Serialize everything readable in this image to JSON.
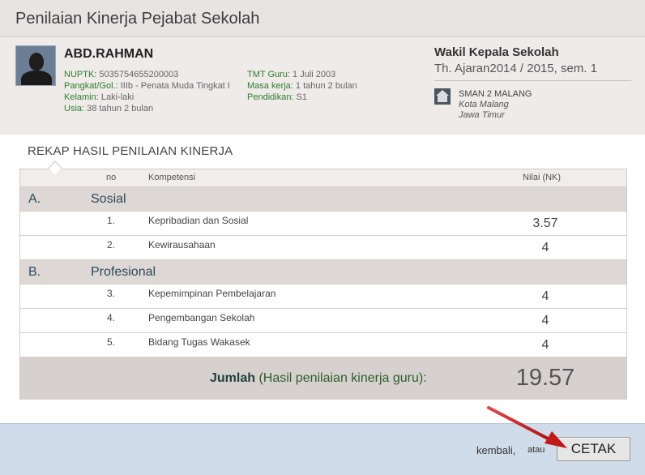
{
  "page_title": "Penilaian Kinerja Pejabat Sekolah",
  "profile": {
    "name": "ABD.RAHMAN",
    "nuptk_label": "NUPTK:",
    "nuptk_value": "5035754655200003",
    "pangkat_label": "Pangkat/Gol.:",
    "pangkat_value": "IIIb - Penata Muda Tingkat I",
    "kelamin_label": "Kelamin:",
    "kelamin_value": "Laki-laki",
    "usia_label": "Usia:",
    "usia_value": "38 tahun 2 bulan",
    "tmt_label": "TMT Guru:",
    "tmt_value": "1 Juli 2003",
    "masa_label": "Masa kerja:",
    "masa_value": "1 tahun 2 bulan",
    "pendidikan_label": "Pendidikan:",
    "pendidikan_value": "S1",
    "role": "Wakil Kepala Sekolah",
    "year": "Th. Ajaran2014 / 2015, sem. 1",
    "school_name": "SMAN 2 MALANG",
    "school_city": "Kota Malang",
    "school_province": "Jawa Timur"
  },
  "rekap": {
    "title": "REKAP HASIL PENILAIAN KINERJA",
    "col_no": "no",
    "col_kompetensi": "Kompetensi",
    "col_nilai": "Nilai (NK)",
    "categories": [
      {
        "letter": "A.",
        "name": "Sosial",
        "items": [
          {
            "no": "1.",
            "kompetensi": "Kepribadian dan Sosial",
            "nilai": "3.57"
          },
          {
            "no": "2.",
            "kompetensi": "Kewirausahaan",
            "nilai": "4"
          }
        ]
      },
      {
        "letter": "B.",
        "name": "Profesional",
        "items": [
          {
            "no": "3.",
            "kompetensi": "Kepemimpinan Pembelajaran",
            "nilai": "4"
          },
          {
            "no": "4.",
            "kompetensi": "Pengembangan Sekolah",
            "nilai": "4"
          },
          {
            "no": "5.",
            "kompetensi": "Bidang Tugas Wakasek",
            "nilai": "4"
          }
        ]
      }
    ],
    "total_bold": "Jumlah",
    "total_rest": " (Hasil penilaian kinerja guru):",
    "total_value": "19.57"
  },
  "footer": {
    "kembali": "kembali,",
    "atau": "atau",
    "cetak": "CETAK"
  },
  "colors": {
    "accent_green": "#2e7d2e",
    "category_blue": "#2d4a5a",
    "arrow_red": "#cc1f1f"
  }
}
